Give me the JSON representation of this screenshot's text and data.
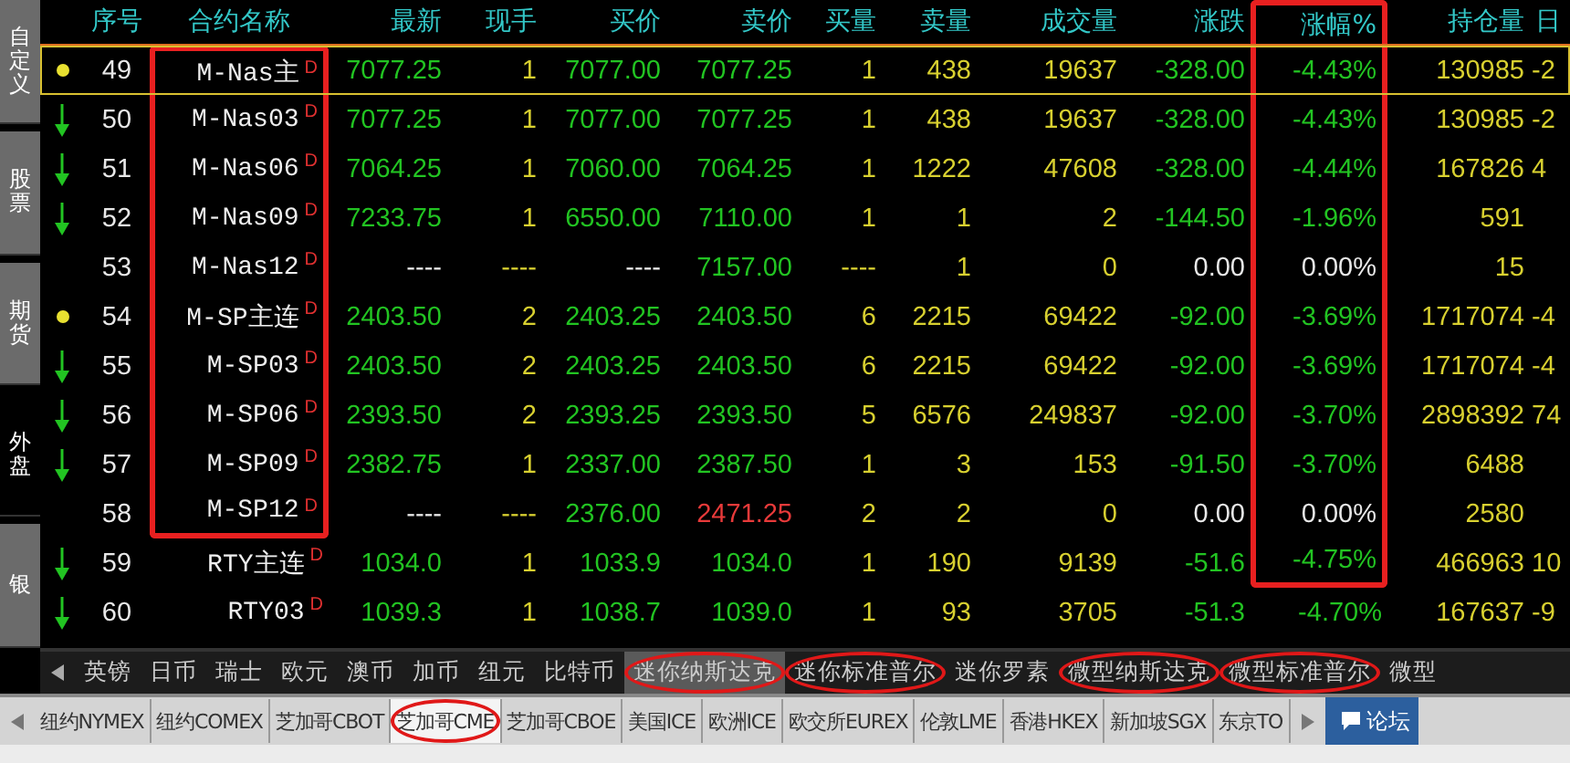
{
  "sidebar": [
    {
      "label": "自定义",
      "selected": false
    },
    {
      "label": "股票",
      "selected": false
    },
    {
      "label": "期货",
      "selected": false
    },
    {
      "label": "外盘",
      "selected": true
    },
    {
      "label": "银",
      "selected": false
    }
  ],
  "table": {
    "columns": [
      {
        "label": "序号",
        "boxed": false
      },
      {
        "label": "合约名称",
        "boxed": false
      },
      {
        "label": "最新",
        "boxed": false
      },
      {
        "label": "现手",
        "boxed": false
      },
      {
        "label": "买价",
        "boxed": false
      },
      {
        "label": "卖价",
        "boxed": false
      },
      {
        "label": "买量",
        "boxed": false
      },
      {
        "label": "卖量",
        "boxed": false
      },
      {
        "label": "成交量",
        "boxed": false
      },
      {
        "label": "涨跌",
        "boxed": false
      },
      {
        "label": "涨幅%",
        "boxed": true
      },
      {
        "label": "持仓量",
        "boxed": false
      },
      {
        "label": "日",
        "boxed": false
      }
    ],
    "rows": [
      {
        "dot": true,
        "arrow": false,
        "selected": true,
        "falling": true,
        "bid_down": true,
        "ask_down": true,
        "ask_up": false,
        "name_boxed": true,
        "pct_boxed": true,
        "no": "49",
        "name": "M-Nas主",
        "flag": "D",
        "latest": "7077.25",
        "lot": "1",
        "bid": "7077.00",
        "ask": "7077.25",
        "bidvol": "1",
        "askvol": "438",
        "volume": "19637",
        "change": "-328.00",
        "pct": "-4.43%",
        "oi": "130985",
        "column_13": "-2"
      },
      {
        "dot": false,
        "arrow": true,
        "selected": false,
        "falling": true,
        "bid_down": true,
        "ask_down": true,
        "ask_up": false,
        "name_boxed": true,
        "pct_boxed": true,
        "no": "50",
        "name": "M-Nas03",
        "flag": "D",
        "latest": "7077.25",
        "lot": "1",
        "bid": "7077.00",
        "ask": "7077.25",
        "bidvol": "1",
        "askvol": "438",
        "volume": "19637",
        "change": "-328.00",
        "pct": "-4.43%",
        "oi": "130985",
        "column_13": "-2"
      },
      {
        "dot": false,
        "arrow": true,
        "selected": false,
        "falling": true,
        "bid_down": true,
        "ask_down": true,
        "ask_up": false,
        "name_boxed": true,
        "pct_boxed": true,
        "no": "51",
        "name": "M-Nas06",
        "flag": "D",
        "latest": "7064.25",
        "lot": "1",
        "bid": "7060.00",
        "ask": "7064.25",
        "bidvol": "1",
        "askvol": "1222",
        "volume": "47608",
        "change": "-328.00",
        "pct": "-4.44%",
        "oi": "167826",
        "column_13": "4"
      },
      {
        "dot": false,
        "arrow": true,
        "selected": false,
        "falling": true,
        "bid_down": true,
        "ask_down": true,
        "ask_up": false,
        "name_boxed": true,
        "pct_boxed": true,
        "no": "52",
        "name": "M-Nas09",
        "flag": "D",
        "latest": "7233.75",
        "lot": "1",
        "bid": "6550.00",
        "ask": "7110.00",
        "bidvol": "1",
        "askvol": "1",
        "volume": "2",
        "change": "-144.50",
        "pct": "-1.96%",
        "oi": "591"
      },
      {
        "dot": false,
        "arrow": false,
        "selected": false,
        "falling": false,
        "bid_down": false,
        "ask_down": true,
        "ask_up": false,
        "name_boxed": true,
        "pct_boxed": true,
        "no": "53",
        "name": "M-Nas12",
        "flag": "D",
        "latest": "----",
        "lot": "----",
        "bid": "----",
        "ask": "7157.00",
        "bidvol": "----",
        "askvol": "1",
        "volume": "0",
        "change": "0.00",
        "pct": "0.00%",
        "oi": "15"
      },
      {
        "dot": true,
        "arrow": false,
        "selected": false,
        "falling": true,
        "bid_down": true,
        "ask_down": true,
        "ask_up": false,
        "name_boxed": true,
        "pct_boxed": true,
        "no": "54",
        "name": "M-SP主连",
        "flag": "D",
        "latest": "2403.50",
        "lot": "2",
        "bid": "2403.25",
        "ask": "2403.50",
        "bidvol": "6",
        "askvol": "2215",
        "volume": "69422",
        "change": "-92.00",
        "pct": "-3.69%",
        "oi": "1717074",
        "column_13": "-4"
      },
      {
        "dot": false,
        "arrow": true,
        "selected": false,
        "falling": true,
        "bid_down": true,
        "ask_down": true,
        "ask_up": false,
        "name_boxed": true,
        "pct_boxed": true,
        "no": "55",
        "name": "M-SP03",
        "flag": "D",
        "latest": "2403.50",
        "lot": "2",
        "bid": "2403.25",
        "ask": "2403.50",
        "bidvol": "6",
        "askvol": "2215",
        "volume": "69422",
        "change": "-92.00",
        "pct": "-3.69%",
        "oi": "1717074",
        "column_13": "-4"
      },
      {
        "dot": false,
        "arrow": true,
        "selected": false,
        "falling": true,
        "bid_down": true,
        "ask_down": true,
        "ask_up": false,
        "name_boxed": true,
        "pct_boxed": true,
        "no": "56",
        "name": "M-SP06",
        "flag": "D",
        "latest": "2393.50",
        "lot": "2",
        "bid": "2393.25",
        "ask": "2393.50",
        "bidvol": "5",
        "askvol": "6576",
        "volume": "249837",
        "change": "-92.00",
        "pct": "-3.70%",
        "oi": "2898392",
        "column_13": "74"
      },
      {
        "dot": false,
        "arrow": true,
        "selected": false,
        "falling": true,
        "bid_down": true,
        "ask_down": true,
        "ask_up": false,
        "name_boxed": true,
        "pct_boxed": true,
        "no": "57",
        "name": "M-SP09",
        "flag": "D",
        "latest": "2382.75",
        "lot": "1",
        "bid": "2337.00",
        "ask": "2387.50",
        "bidvol": "1",
        "askvol": "3",
        "volume": "153",
        "change": "-91.50",
        "pct": "-3.70%",
        "oi": "6488"
      },
      {
        "dot": false,
        "arrow": false,
        "selected": false,
        "falling": false,
        "bid_down": true,
        "ask_down": false,
        "ask_up": true,
        "name_boxed": true,
        "pct_boxed": true,
        "no": "58",
        "name": "M-SP12",
        "flag": "D",
        "latest": "----",
        "lot": "----",
        "bid": "2376.00",
        "ask": "2471.25",
        "bidvol": "2",
        "askvol": "2",
        "volume": "0",
        "change": "0.00",
        "pct": "0.00%",
        "oi": "2580"
      },
      {
        "dot": false,
        "arrow": true,
        "selected": false,
        "falling": true,
        "bid_down": true,
        "ask_down": true,
        "ask_up": false,
        "name_boxed": false,
        "pct_boxed": true,
        "no": "59",
        "name": "RTY主连",
        "flag": "D",
        "latest": "1034.0",
        "lot": "1",
        "bid": "1033.9",
        "ask": "1034.0",
        "bidvol": "1",
        "askvol": "190",
        "volume": "9139",
        "change": "-51.6",
        "pct": "-4.75%",
        "oi": "466963",
        "column_13": "10"
      },
      {
        "dot": false,
        "arrow": true,
        "selected": false,
        "falling": true,
        "bid_down": true,
        "ask_down": true,
        "ask_up": false,
        "name_boxed": false,
        "pct_boxed": false,
        "no": "60",
        "name": "RTY03",
        "flag": "D",
        "latest": "1039.3",
        "lot": "1",
        "bid": "1038.7",
        "ask": "1039.0",
        "bidvol": "1",
        "askvol": "93",
        "volume": "3705",
        "change": "-51.3",
        "pct": "-4.70%",
        "oi": "167637",
        "column_13": "-9"
      }
    ]
  },
  "currency_tabs": [
    {
      "label": "英镑",
      "selected": false,
      "circled": false
    },
    {
      "label": "日币",
      "selected": false,
      "circled": false
    },
    {
      "label": "瑞士",
      "selected": false,
      "circled": false
    },
    {
      "label": "欧元",
      "selected": false,
      "circled": false
    },
    {
      "label": "澳币",
      "selected": false,
      "circled": false
    },
    {
      "label": "加币",
      "selected": false,
      "circled": false
    },
    {
      "label": "纽元",
      "selected": false,
      "circled": false
    },
    {
      "label": "比特币",
      "selected": false,
      "circled": false
    },
    {
      "label": "迷你纳斯达克",
      "selected": true,
      "circled": true
    },
    {
      "label": "迷你标准普尔",
      "selected": false,
      "circled": true
    },
    {
      "label": "迷你罗素",
      "selected": false,
      "circled": false
    },
    {
      "label": "微型纳斯达克",
      "selected": false,
      "circled": true
    },
    {
      "label": "微型标准普尔",
      "selected": false,
      "circled": true
    },
    {
      "label": "微型",
      "selected": false,
      "circled": false
    }
  ],
  "exchange_tabs": [
    {
      "label": "纽约NYMEX",
      "selected": false,
      "circled": false
    },
    {
      "label": "纽约COMEX",
      "selected": false,
      "circled": false
    },
    {
      "label": "芝加哥CBOT",
      "selected": false,
      "circled": false
    },
    {
      "label": "芝加哥CME",
      "selected": true,
      "circled": true
    },
    {
      "label": "芝加哥CBOE",
      "selected": false,
      "circled": false
    },
    {
      "label": "美国ICE",
      "selected": false,
      "circled": false
    },
    {
      "label": "欧洲ICE",
      "selected": false,
      "circled": false
    },
    {
      "label": "欧交所EUREX",
      "selected": false,
      "circled": false
    },
    {
      "label": "伦敦LME",
      "selected": false,
      "circled": false
    },
    {
      "label": "香港HKEX",
      "selected": false,
      "circled": false
    },
    {
      "label": "新加坡SGX",
      "selected": false,
      "circled": false
    },
    {
      "label": "东京TO",
      "selected": false,
      "circled": false
    }
  ],
  "forum_button": {
    "label": "论坛"
  }
}
